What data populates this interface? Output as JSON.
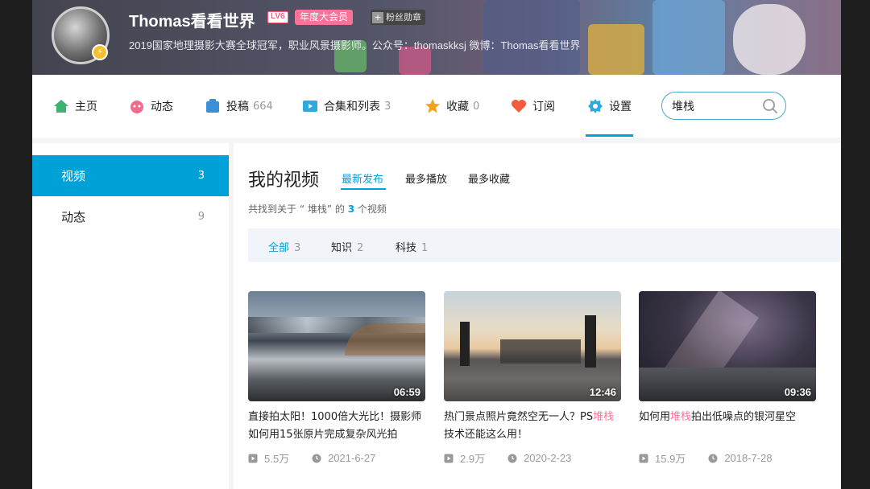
{
  "header": {
    "username": "Thomas看看世界",
    "level_badge": "LV6",
    "vip_badge": "年度大会员",
    "fan_badge_icon": "+",
    "fan_badge": "粉丝勋章",
    "signature": "2019国家地理摄影大赛全球冠军，职业风景摄影师。公众号：thomaskksj 微博：Thomas看看世界",
    "avatar_badge_icon": "lightning-icon"
  },
  "nav": {
    "items": [
      {
        "label": "主页",
        "count": "",
        "icon": "home-icon",
        "color": "#3cb371"
      },
      {
        "label": "动态",
        "count": "",
        "icon": "dynamic-icon",
        "color": "#f26b8c"
      },
      {
        "label": "投稿",
        "count": "664",
        "icon": "upload-icon",
        "color": "#3a8fd6"
      },
      {
        "label": "合集和列表",
        "count": "3",
        "icon": "collection-icon",
        "color": "#2fa8dd"
      },
      {
        "label": "收藏",
        "count": "0",
        "icon": "favorite-icon",
        "color": "#f2a31b"
      },
      {
        "label": "订阅",
        "count": "",
        "icon": "subscribe-icon",
        "color": "#f25c3a"
      },
      {
        "label": "设置",
        "count": "",
        "icon": "settings-icon",
        "color": "#2fa8dd"
      }
    ],
    "search": {
      "value": "堆栈",
      "placeholder": ""
    }
  },
  "sidebar": {
    "items": [
      {
        "label": "视频",
        "count": "3",
        "active": true
      },
      {
        "label": "动态",
        "count": "9",
        "active": false
      }
    ]
  },
  "main": {
    "title": "我的视频",
    "sort_tabs": [
      {
        "label": "最新发布",
        "active": true
      },
      {
        "label": "最多播放",
        "active": false
      },
      {
        "label": "最多收藏",
        "active": false
      }
    ],
    "found": {
      "prefix": "共找到关于 “ 堆栈” 的 ",
      "count": "3",
      "suffix": " 个视频"
    },
    "filters": [
      {
        "label": "全部",
        "count": "3",
        "active": true
      },
      {
        "label": "知识",
        "count": "2",
        "active": false
      },
      {
        "label": "科技",
        "count": "1",
        "active": false
      }
    ],
    "videos": [
      {
        "duration": "06:59",
        "title_parts": [
          "直接拍太阳！1000倍大光比！摄影师如何用15张原片完成复杂风光拍",
          "",
          ""
        ],
        "plays": "5.5万",
        "date": "2021-6-27"
      },
      {
        "duration": "12:46",
        "title_parts": [
          "热门景点照片竟然空无一人？PS",
          "堆栈",
          "技术还能这么用！"
        ],
        "plays": "2.9万",
        "date": "2020-2-23"
      },
      {
        "duration": "09:36",
        "title_parts": [
          "如何用",
          "堆栈",
          "拍出低噪点的银河星空"
        ],
        "plays": "15.9万",
        "date": "2018-7-28"
      }
    ]
  },
  "colors": {
    "accent": "#00a1d6",
    "pink": "#fb7299"
  }
}
